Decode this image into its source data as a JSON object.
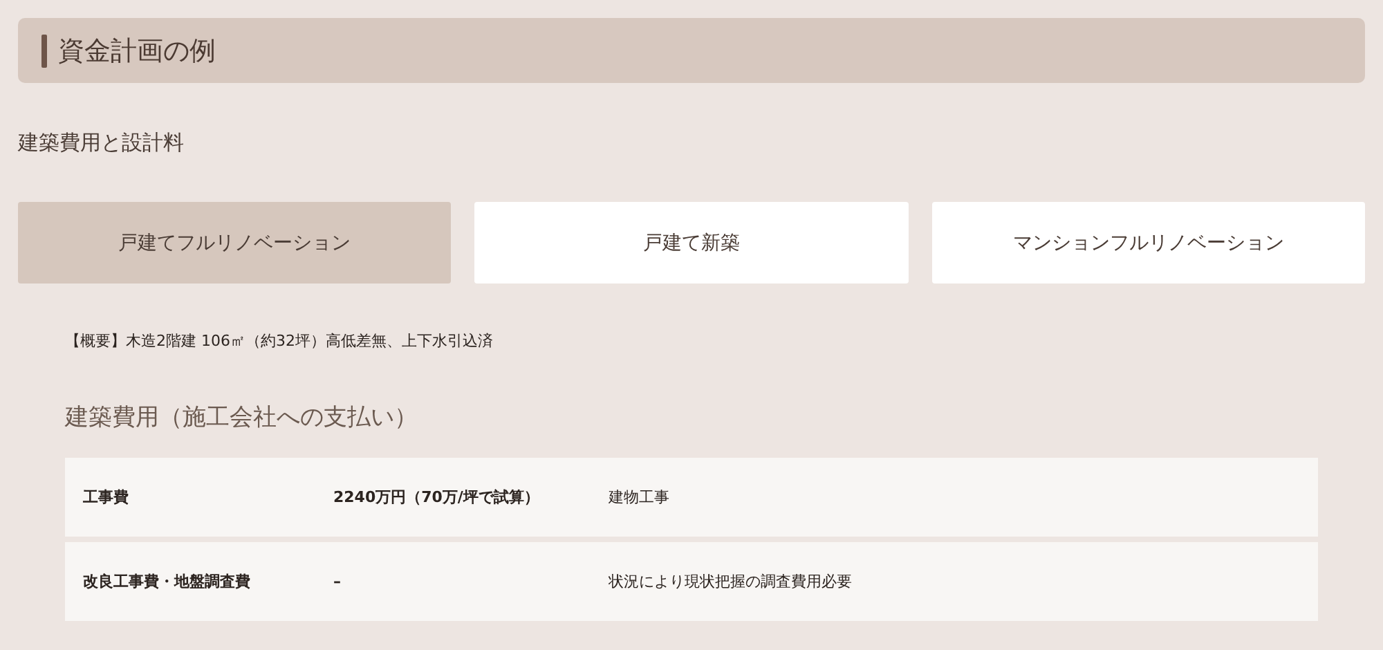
{
  "header": {
    "title": "資金計画の例"
  },
  "subtitle": "建築費用と設計料",
  "tabs": [
    {
      "label": "戸建てフルリノベーション",
      "selected": true
    },
    {
      "label": "戸建て新築",
      "selected": false
    },
    {
      "label": "マンションフルリノベーション",
      "selected": false
    }
  ],
  "overview": "【概要】木造2階建 106㎡（約32坪）高低差無、上下水引込済",
  "section": {
    "title": "建築費用（施工会社への支払い）"
  },
  "table": {
    "rows": [
      {
        "item": "工事費",
        "amount": "2240万円（70万/坪で試算）",
        "note": "建物工事"
      },
      {
        "item": "改良工事費・地盤調査費",
        "amount": "–",
        "note": "状況により現状把握の調査費用必要"
      }
    ]
  }
}
